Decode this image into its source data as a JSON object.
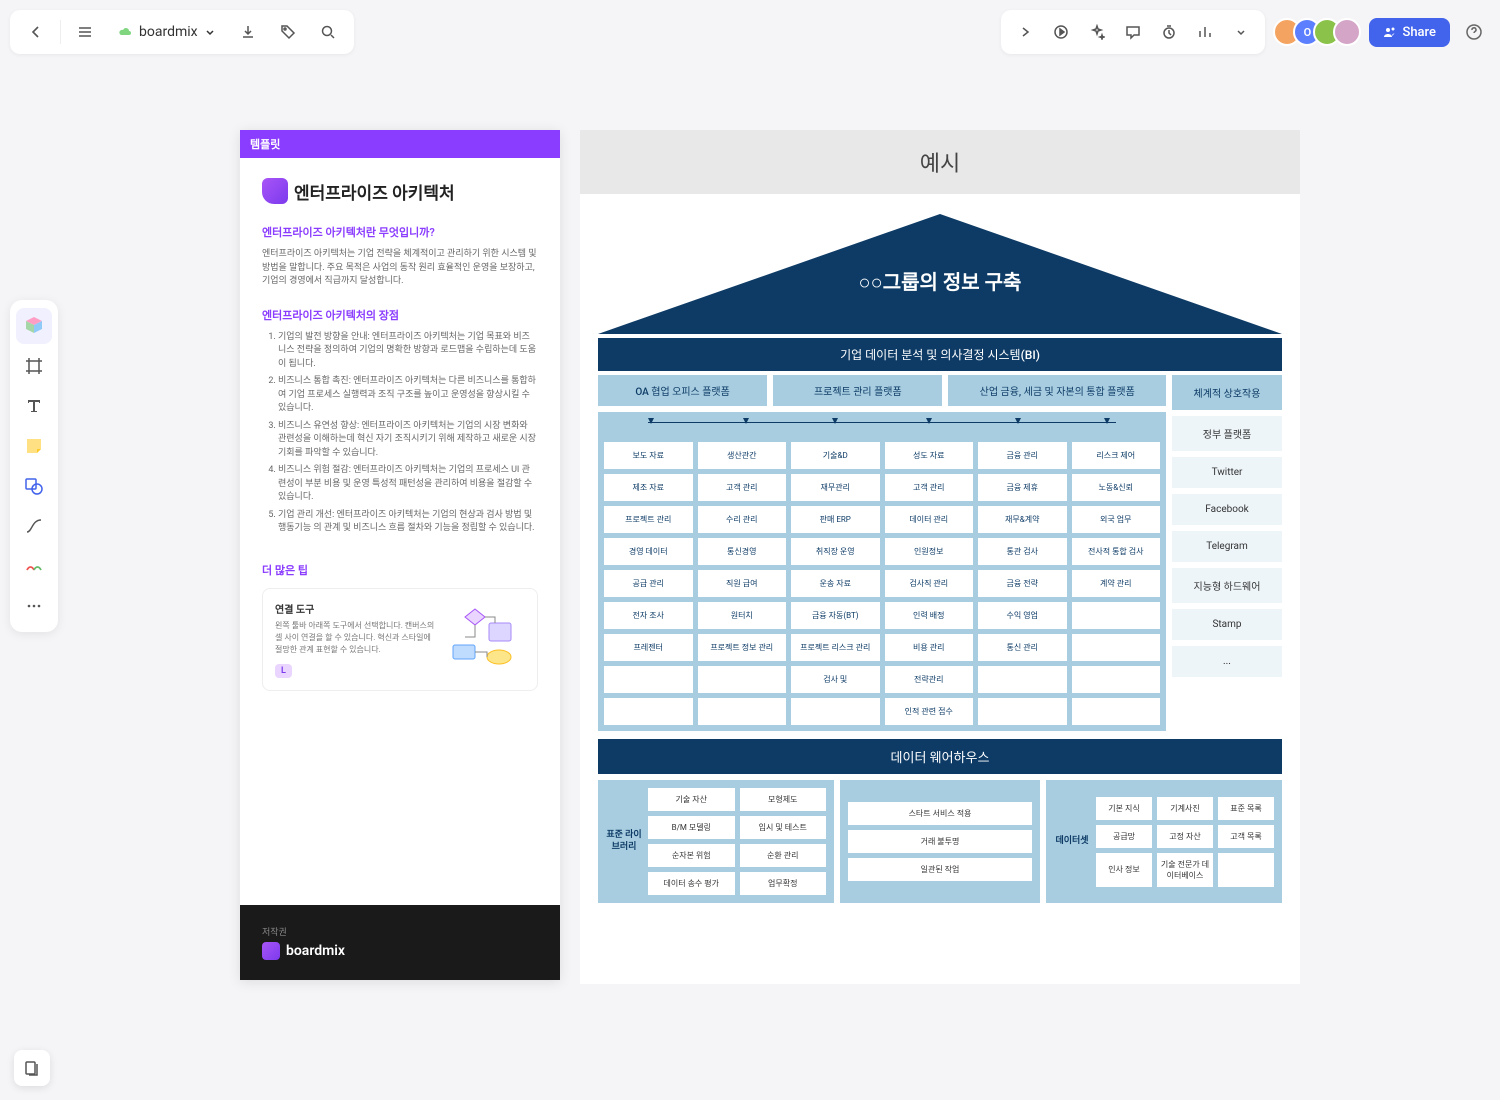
{
  "topbar": {
    "title": "boardmix",
    "share": "Share"
  },
  "template": {
    "ribbon": "템플릿",
    "title": "엔터프라이즈 아키텍처",
    "q_title": "엔터프라이즈 아키텍처란 무엇입니까?",
    "q_desc": "엔터프라이즈 아키텍처는 기업 전략을 체계적이고 관리하기 위한 시스템 및 방법을 말합니다. 주요 목적은 사업의 동작 원리 효율적인 운영을 보장하고, 기업의 경영에서 직급까지 달성합니다.",
    "adv_title": "엔터프라이즈 아키텍처의 장점",
    "adv": [
      "기업의 발전 방향을 안내: 엔터프라이즈 아키텍처는 기업 목표와 비즈니스 전략을 정의하여 기업의 명확한 방향과 로드맵을 수립하는데 도움이 됩니다.",
      "비즈니스 통합 촉진: 엔터프라이즈 아키텍처는 다른 비즈니스를 통합하여 기업 프로세스 실행력과 조직 구조를 높이고 운영성을 향상시킬 수 있습니다.",
      "비즈니스 유연성 향상: 엔터프라이즈 아키텍처는 기업의 시장 변화와 관련성을 이해하는데 혁신 자기 조직시키기 위해 제작하고 새로운 시장 기회를 파악할 수 있습니다.",
      "비즈니스 위험 절감: 엔터프라이즈 아키텍처는 기업의 프로세스 UI 관련성이 부분 비용 및 운영 특성적 패턴성을 관리하여 비용을 절감할 수 있습니다.",
      "기업 관리 개선: 엔터프라이즈 아키텍처는 기업의 현상과 검사 방법 및 행동기능 의 관계 및 비즈니스 흐름 절차와 기능을 정립할 수 있습니다."
    ],
    "tip_heading": "더 많은 팁",
    "tip_title": "연결 도구",
    "tip_desc": "왼쪽 툴바 아래쪽 도구에서 선택합니다. 캔버스의 셀 사이 연결을 할 수 있습니다. 혁신과 스타일에 절망한 관계 표현할 수 있습니다.",
    "tip_badge": "L",
    "foot_label": "저작권",
    "foot_brand": "boardmix"
  },
  "example": {
    "heading": "예시",
    "roof": "○○그룹의 정보 구축",
    "bi": "기업 데이터 분석 및 의사결정 시스템(BI)",
    "platforms": [
      "OA 협업 오피스 플랫폼",
      "프로젝트 관리 플랫폼",
      "산업 금융, 세금 및 자본의 통합 플랫폼"
    ],
    "grid": [
      "보도 자료",
      "생산관간",
      "기술&D",
      "성도 자료",
      "금융 관리",
      "리스크 제어",
      "제조 자료",
      "고객 관리",
      "재무관리",
      "고객 관리",
      "금융 제휴",
      "노동&신뢰",
      "프로젝트 관리",
      "수리 관리",
      "판매 ERP",
      "데이터 관리",
      "재무&계약",
      "외국 업무",
      "경영 데이터",
      "통신경영",
      "취직장 운영",
      "인원정보",
      "통관 검사",
      "전사적 통합 검사",
      "공급 관리",
      "직원 급여",
      "운송 자료",
      "검사직 관리",
      "금융 전략",
      "계약 관리",
      "전자 조사",
      "원터치",
      "금융 자동(BT)",
      "인력 배정",
      "수익 영업",
      "",
      "프레젠터",
      "프로젝트 정보 관리",
      "프로젝트 리스크 관리",
      "비용 관리",
      "통신 관리",
      "",
      "",
      "",
      "검사 및",
      "전략관리",
      "",
      "",
      "",
      "",
      "",
      "인적 관련 접수",
      "",
      ""
    ],
    "side_title": "체계적 상호작용",
    "side": [
      "정부 플랫폼",
      "Twitter",
      "Facebook",
      "Telegram",
      "지능형 하드웨어",
      "Stamp",
      "..."
    ],
    "dw": "데이터 웨어하우스",
    "lib_label": "표준 라이브러리",
    "lib": [
      "기술 자산",
      "모형제도",
      "B/M 모델링",
      "입시 및 테스트",
      "순자본 위험",
      "순환 관리",
      "데이터 송수 평가",
      "업무확정"
    ],
    "mid": [
      "스타트 서비스 적용",
      "거래 불투명",
      "일관된 작업"
    ],
    "ds_label": "데이터셋",
    "ds": [
      "기본 지식",
      "기계사진",
      "표준 목록",
      "공급망",
      "고정 자산",
      "고객 목록",
      "인사 정보",
      "기술 전문가 데이터베이스",
      ""
    ]
  }
}
